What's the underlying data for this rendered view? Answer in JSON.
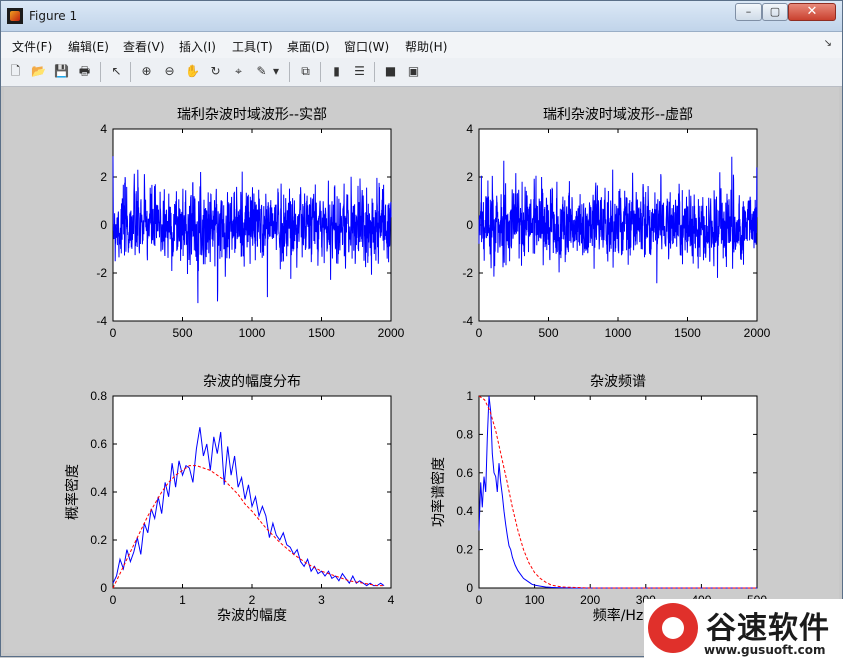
{
  "window": {
    "title": "Figure 1",
    "min_label": "–",
    "max_label": "▢",
    "close_label": "✕"
  },
  "menu": [
    "文件(F)",
    "编辑(E)",
    "查看(V)",
    "插入(I)",
    "工具(T)",
    "桌面(D)",
    "窗口(W)",
    "帮助(H)"
  ],
  "toolbar_icons": [
    "new-file-icon",
    "open-file-icon",
    "save-icon",
    "print-icon",
    "pointer-icon",
    "zoom-in-icon",
    "zoom-out-icon",
    "pan-icon",
    "rotate-3d-icon",
    "data-cursor-icon",
    "brush-icon",
    "dropdown-arrow-icon",
    "link-plot-icon",
    "colorbar-icon",
    "legend-icon",
    "hide-plot-tools-icon",
    "show-plot-tools-icon"
  ],
  "chart_data": [
    {
      "type": "line",
      "title": "瑞利杂波时域波形--实部",
      "xlabel": "",
      "ylabel": "",
      "xlim": [
        0,
        2000
      ],
      "ylim": [
        -4,
        4
      ],
      "xticks": [
        "0",
        "500",
        "1000",
        "1500",
        "2000"
      ],
      "yticks": [
        "-4",
        "-2",
        "0",
        "2",
        "4"
      ],
      "series": [
        {
          "color": "#0000ff",
          "points": 1400,
          "seed": 7
        }
      ]
    },
    {
      "type": "line",
      "title": "瑞利杂波时域波形--虚部",
      "xlabel": "",
      "ylabel": "",
      "xlim": [
        0,
        2000
      ],
      "ylim": [
        -4,
        4
      ],
      "xticks": [
        "0",
        "500",
        "1000",
        "1500",
        "2000"
      ],
      "yticks": [
        "-4",
        "-2",
        "0",
        "2",
        "4"
      ],
      "series": [
        {
          "color": "#0000ff",
          "points": 1400,
          "seed": 13
        }
      ]
    },
    {
      "type": "line",
      "title": "杂波的幅度分布",
      "xlabel": "杂波的幅度",
      "ylabel": "概率密度",
      "xlim": [
        0,
        4
      ],
      "ylim": [
        0,
        0.8
      ],
      "xticks": [
        "0",
        "1",
        "2",
        "3",
        "4"
      ],
      "yticks": [
        "0",
        "0.2",
        "0.4",
        "0.6",
        "0.8"
      ],
      "series": [
        {
          "name": "",
          "color": "#0000ff",
          "style": "solid",
          "x": [
            0,
            0.05,
            0.1,
            0.15,
            0.2,
            0.25,
            0.3,
            0.35,
            0.4,
            0.45,
            0.5,
            0.55,
            0.6,
            0.65,
            0.7,
            0.75,
            0.8,
            0.85,
            0.9,
            0.95,
            1.0,
            1.05,
            1.1,
            1.15,
            1.2,
            1.25,
            1.3,
            1.35,
            1.4,
            1.45,
            1.5,
            1.55,
            1.6,
            1.65,
            1.7,
            1.75,
            1.8,
            1.85,
            1.9,
            1.95,
            2.0,
            2.05,
            2.1,
            2.15,
            2.2,
            2.25,
            2.3,
            2.35,
            2.4,
            2.45,
            2.5,
            2.55,
            2.6,
            2.65,
            2.7,
            2.75,
            2.8,
            2.85,
            2.9,
            2.95,
            3.0,
            3.05,
            3.1,
            3.15,
            3.2,
            3.25,
            3.3,
            3.35,
            3.4,
            3.45,
            3.5,
            3.55,
            3.6,
            3.65,
            3.7,
            3.75,
            3.8,
            3.85,
            3.9
          ],
          "y": [
            0.02,
            0.05,
            0.12,
            0.08,
            0.16,
            0.11,
            0.15,
            0.21,
            0.14,
            0.27,
            0.23,
            0.33,
            0.29,
            0.38,
            0.31,
            0.44,
            0.38,
            0.52,
            0.42,
            0.53,
            0.47,
            0.51,
            0.5,
            0.44,
            0.58,
            0.67,
            0.55,
            0.6,
            0.49,
            0.63,
            0.56,
            0.65,
            0.43,
            0.59,
            0.47,
            0.55,
            0.42,
            0.46,
            0.37,
            0.43,
            0.34,
            0.38,
            0.3,
            0.34,
            0.3,
            0.21,
            0.27,
            0.22,
            0.2,
            0.23,
            0.18,
            0.17,
            0.14,
            0.16,
            0.11,
            0.09,
            0.12,
            0.07,
            0.09,
            0.06,
            0.07,
            0.05,
            0.07,
            0.04,
            0.05,
            0.03,
            0.06,
            0.04,
            0.02,
            0.05,
            0.02,
            0.03,
            0.02,
            0.01,
            0.02,
            0.01,
            0.01,
            0.02,
            0.01
          ]
        },
        {
          "name": "",
          "color": "#ff0000",
          "style": "dashed",
          "x": [
            0,
            0.1,
            0.2,
            0.3,
            0.4,
            0.5,
            0.6,
            0.7,
            0.8,
            0.9,
            1.0,
            1.1,
            1.2,
            1.3,
            1.4,
            1.5,
            1.6,
            1.7,
            1.8,
            1.9,
            2.0,
            2.2,
            2.4,
            2.6,
            2.8,
            3.0,
            3.2,
            3.4,
            3.6,
            3.8,
            3.9
          ],
          "y": [
            0,
            0.06,
            0.12,
            0.18,
            0.24,
            0.3,
            0.35,
            0.4,
            0.44,
            0.47,
            0.49,
            0.51,
            0.51,
            0.5,
            0.49,
            0.47,
            0.45,
            0.42,
            0.39,
            0.35,
            0.32,
            0.25,
            0.19,
            0.14,
            0.1,
            0.07,
            0.05,
            0.03,
            0.02,
            0.01,
            0.01
          ]
        }
      ]
    },
    {
      "type": "line",
      "title": "杂波频谱",
      "xlabel": "频率/Hz",
      "ylabel": "功率谱密度",
      "xlim": [
        0,
        500
      ],
      "ylim": [
        0,
        1
      ],
      "xticks": [
        "0",
        "100",
        "200",
        "300",
        "400",
        "500"
      ],
      "yticks": [
        "0",
        "0.2",
        "0.4",
        "0.6",
        "0.8",
        "1"
      ],
      "series": [
        {
          "name": "",
          "color": "#0000ff",
          "style": "solid",
          "x": [
            0,
            3,
            6,
            9,
            12,
            15,
            18,
            21,
            24,
            27,
            30,
            33,
            36,
            39,
            42,
            45,
            48,
            51,
            54,
            57,
            60,
            65,
            70,
            75,
            80,
            85,
            90,
            95,
            100,
            110,
            120,
            130,
            140,
            150,
            175,
            200,
            250,
            300,
            350,
            400,
            450,
            500
          ],
          "y": [
            0.3,
            0.55,
            0.42,
            0.58,
            0.5,
            0.78,
            1.0,
            0.92,
            0.7,
            0.6,
            0.58,
            0.5,
            0.65,
            0.55,
            0.48,
            0.4,
            0.33,
            0.27,
            0.22,
            0.2,
            0.16,
            0.12,
            0.09,
            0.07,
            0.05,
            0.04,
            0.03,
            0.02,
            0.015,
            0.01,
            0.005,
            0.003,
            0.002,
            0.001,
            0,
            0,
            0,
            0,
            0,
            0,
            0,
            0
          ]
        },
        {
          "name": "",
          "color": "#ff0000",
          "style": "dashed",
          "x": [
            0,
            10,
            20,
            30,
            40,
            50,
            60,
            70,
            80,
            90,
            100,
            110,
            120,
            130,
            150,
            200,
            300,
            400,
            500
          ],
          "y": [
            1,
            0.98,
            0.92,
            0.82,
            0.69,
            0.56,
            0.42,
            0.3,
            0.2,
            0.13,
            0.08,
            0.05,
            0.03,
            0.015,
            0.005,
            0,
            0,
            0,
            0
          ]
        }
      ]
    }
  ],
  "watermark": {
    "brand": "谷速软件",
    "url": "www.gusuoft.com"
  }
}
